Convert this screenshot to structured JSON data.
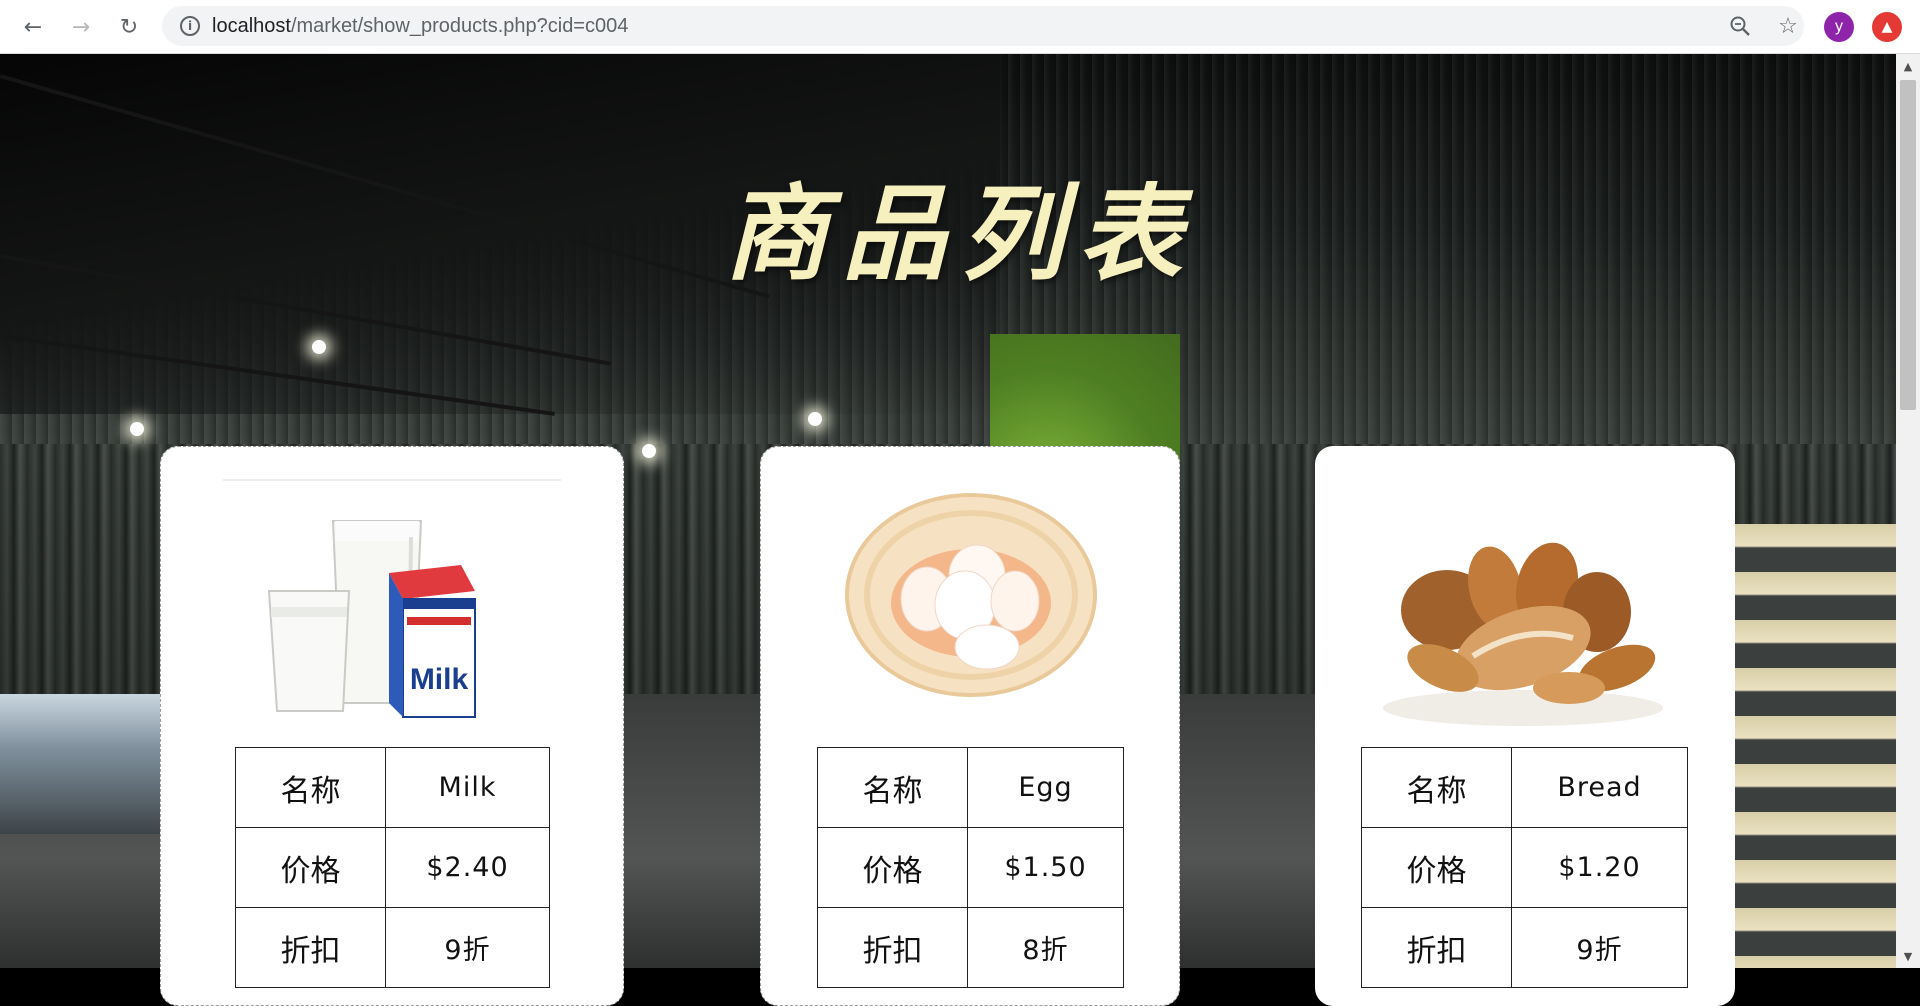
{
  "browser": {
    "url_host": "localhost",
    "url_path": "/market/show_products.php?cid=c004",
    "profile_initial": "y"
  },
  "page": {
    "title": "商品列表"
  },
  "labels": {
    "name": "名称",
    "price": "价格",
    "discount": "折扣"
  },
  "products": [
    {
      "name": "Milk",
      "price": "$2.40",
      "discount": "9折",
      "image": "milk-image"
    },
    {
      "name": "Egg",
      "price": "$1.50",
      "discount": "8折",
      "image": "egg-image"
    },
    {
      "name": "Bread",
      "price": "$1.20",
      "discount": "9折",
      "image": "bread-image"
    }
  ],
  "colors": {
    "title": "#f6efbe",
    "avatar": "#8e24aa",
    "extension": "#e53935"
  }
}
